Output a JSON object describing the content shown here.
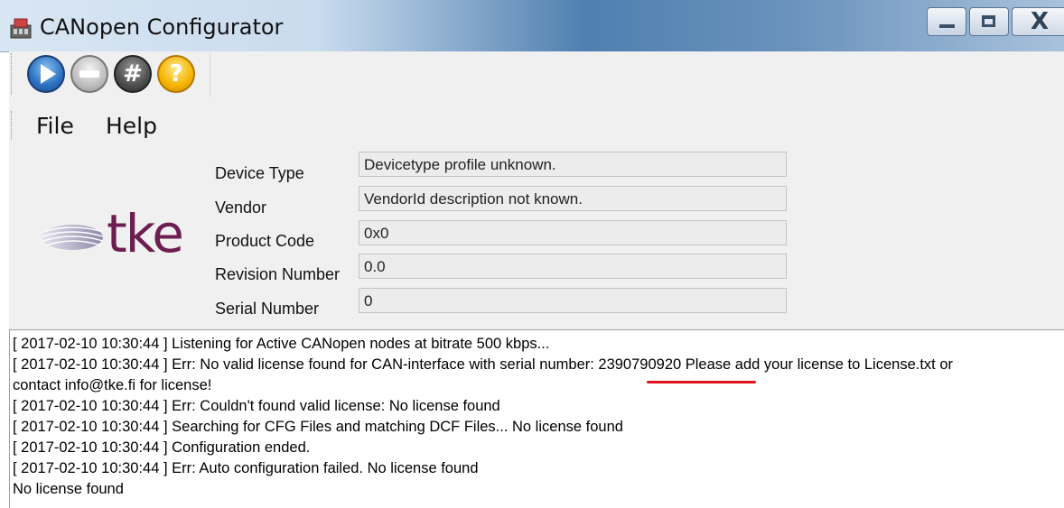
{
  "window": {
    "title": "CANopen Configurator"
  },
  "toolbar": {
    "buttons": [
      "play-icon",
      "stop-icon",
      "hash-icon",
      "help-icon"
    ],
    "hash_glyph": "#",
    "help_glyph": "?"
  },
  "menu": {
    "file": "File",
    "help": "Help"
  },
  "logo": {
    "text": "tke",
    "color": "#6b1e4f"
  },
  "device": {
    "fields": [
      {
        "label": "Device Type",
        "value": "Devicetype profile unknown."
      },
      {
        "label": "Vendor",
        "value": "VendorId description not known."
      },
      {
        "label": "Product Code",
        "value": "0x0"
      },
      {
        "label": "Revision Number",
        "value": "0.0"
      },
      {
        "label": "Serial Number",
        "value": "0"
      }
    ]
  },
  "log": {
    "lines": [
      "[ 2017-02-10 10:30:44 ] Listening for Active CANopen nodes at bitrate 500 kbps...",
      "[ 2017-02-10 10:30:44 ] Err: No valid license found for CAN-interface with serial number: 2390790920 Please add your license to License.txt or",
      "contact info@tke.fi for license!",
      "[ 2017-02-10 10:30:44 ] Err: Couldn't found valid license: No license found",
      "[ 2017-02-10 10:30:44 ] Searching for CFG Files and matching DCF Files... No license found",
      "[ 2017-02-10 10:30:44 ] Configuration ended.",
      "[ 2017-02-10 10:30:44 ] Err: Auto configuration failed. No license found",
      "No license found"
    ],
    "highlight_color": "#e0141e"
  }
}
